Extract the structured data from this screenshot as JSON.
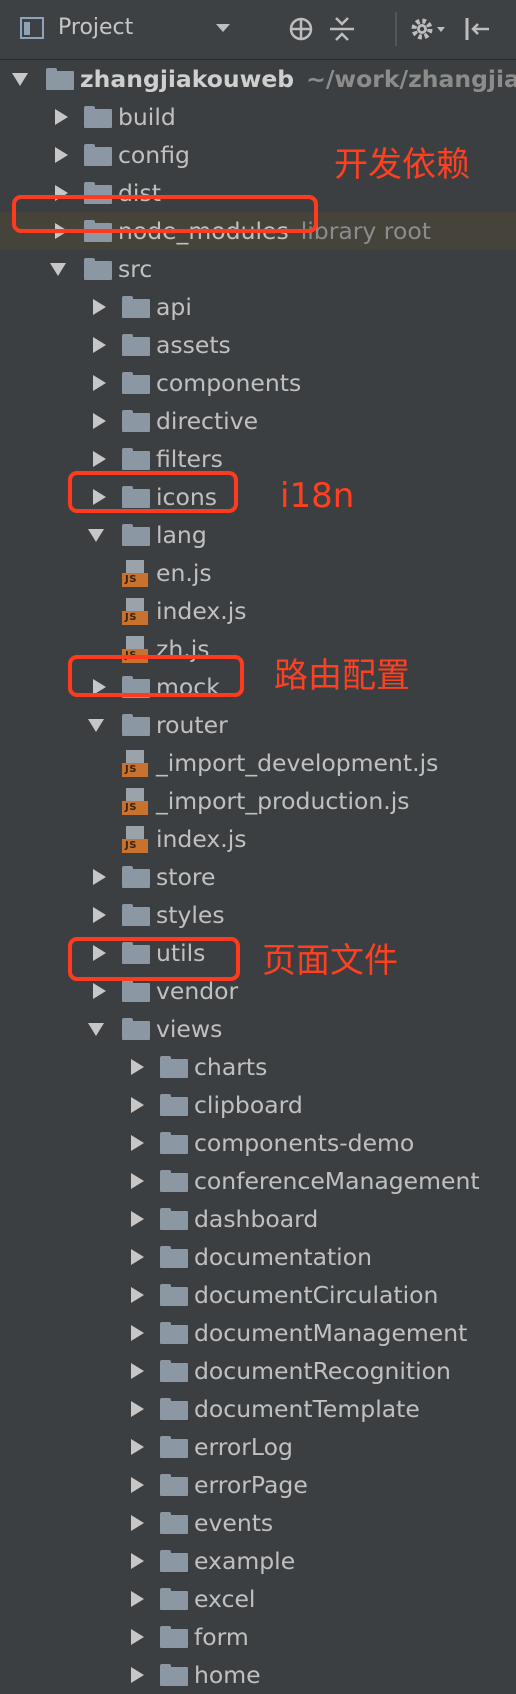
{
  "header": {
    "title": "Project",
    "icons": [
      "project-view-icon",
      "dropdown-arrow-icon",
      "locate-target-icon",
      "collapse-all-icon",
      "settings-gear-icon",
      "hide-panel-icon"
    ]
  },
  "tree": [
    {
      "type": "folder",
      "level": 0,
      "arrow": "down",
      "label": "zhangjiakouweb",
      "hint": "~/work/zhangjia",
      "bold": true
    },
    {
      "type": "folder",
      "level": 1,
      "arrow": "right",
      "label": "build"
    },
    {
      "type": "folder",
      "level": 1,
      "arrow": "right",
      "label": "config"
    },
    {
      "type": "folder",
      "level": 1,
      "arrow": "right",
      "label": "dist"
    },
    {
      "type": "folder",
      "level": 1,
      "arrow": "right",
      "label": "node_modules",
      "hint": "library root",
      "highlight": true
    },
    {
      "type": "folder",
      "level": 1,
      "arrow": "down",
      "label": "src"
    },
    {
      "type": "folder",
      "level": 2,
      "arrow": "right",
      "label": "api"
    },
    {
      "type": "folder",
      "level": 2,
      "arrow": "right",
      "label": "assets"
    },
    {
      "type": "folder",
      "level": 2,
      "arrow": "right",
      "label": "components"
    },
    {
      "type": "folder",
      "level": 2,
      "arrow": "right",
      "label": "directive"
    },
    {
      "type": "folder",
      "level": 2,
      "arrow": "right",
      "label": "filters"
    },
    {
      "type": "folder",
      "level": 2,
      "arrow": "right",
      "label": "icons"
    },
    {
      "type": "folder",
      "level": 2,
      "arrow": "down",
      "label": "lang"
    },
    {
      "type": "file",
      "level": 3,
      "label": "en.js"
    },
    {
      "type": "file",
      "level": 3,
      "label": "index.js"
    },
    {
      "type": "file",
      "level": 3,
      "label": "zh.js"
    },
    {
      "type": "folder",
      "level": 2,
      "arrow": "right",
      "label": "mock"
    },
    {
      "type": "folder",
      "level": 2,
      "arrow": "down",
      "label": "router"
    },
    {
      "type": "file",
      "level": 3,
      "label": "_import_development.js"
    },
    {
      "type": "file",
      "level": 3,
      "label": "_import_production.js"
    },
    {
      "type": "file",
      "level": 3,
      "label": "index.js"
    },
    {
      "type": "folder",
      "level": 2,
      "arrow": "right",
      "label": "store"
    },
    {
      "type": "folder",
      "level": 2,
      "arrow": "right",
      "label": "styles"
    },
    {
      "type": "folder",
      "level": 2,
      "arrow": "right",
      "label": "utils"
    },
    {
      "type": "folder",
      "level": 2,
      "arrow": "right",
      "label": "vendor"
    },
    {
      "type": "folder",
      "level": 2,
      "arrow": "down",
      "label": "views"
    },
    {
      "type": "folder",
      "level": 3,
      "arrow": "right",
      "label": "charts"
    },
    {
      "type": "folder",
      "level": 3,
      "arrow": "right",
      "label": "clipboard"
    },
    {
      "type": "folder",
      "level": 3,
      "arrow": "right",
      "label": "components-demo"
    },
    {
      "type": "folder",
      "level": 3,
      "arrow": "right",
      "label": "conferenceManagement"
    },
    {
      "type": "folder",
      "level": 3,
      "arrow": "right",
      "label": "dashboard"
    },
    {
      "type": "folder",
      "level": 3,
      "arrow": "right",
      "label": "documentation"
    },
    {
      "type": "folder",
      "level": 3,
      "arrow": "right",
      "label": "documentCirculation"
    },
    {
      "type": "folder",
      "level": 3,
      "arrow": "right",
      "label": "documentManagement"
    },
    {
      "type": "folder",
      "level": 3,
      "arrow": "right",
      "label": "documentRecognition"
    },
    {
      "type": "folder",
      "level": 3,
      "arrow": "right",
      "label": "documentTemplate"
    },
    {
      "type": "folder",
      "level": 3,
      "arrow": "right",
      "label": "errorLog"
    },
    {
      "type": "folder",
      "level": 3,
      "arrow": "right",
      "label": "errorPage"
    },
    {
      "type": "folder",
      "level": 3,
      "arrow": "right",
      "label": "events"
    },
    {
      "type": "folder",
      "level": 3,
      "arrow": "right",
      "label": "example"
    },
    {
      "type": "folder",
      "level": 3,
      "arrow": "right",
      "label": "excel"
    },
    {
      "type": "folder",
      "level": 3,
      "arrow": "right",
      "label": "form"
    },
    {
      "type": "folder",
      "level": 3,
      "arrow": "right",
      "label": "home"
    }
  ],
  "file_badge": "JS",
  "annotations": [
    {
      "target": "node_modules",
      "text": "开发依赖"
    },
    {
      "target": "lang",
      "text": "i18n"
    },
    {
      "target": "router",
      "text": "路由配置"
    },
    {
      "target": "views",
      "text": "页面文件"
    }
  ],
  "colors": {
    "annotation": "#ff3b1f",
    "folder": "#8b97a3",
    "js_badge": "#c9712e",
    "background": "#3c3f41"
  }
}
